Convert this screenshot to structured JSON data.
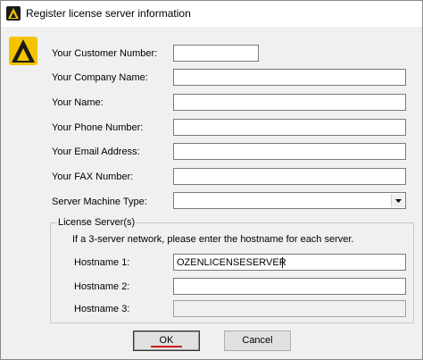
{
  "window": {
    "title": "Register license server information"
  },
  "form": {
    "customer_number": {
      "label": "Your Customer Number:",
      "value": ""
    },
    "company_name": {
      "label": "Your Company Name:",
      "value": ""
    },
    "name": {
      "label": "Your Name:",
      "value": ""
    },
    "phone": {
      "label": "Your Phone Number:",
      "value": ""
    },
    "email": {
      "label": "Your Email Address:",
      "value": ""
    },
    "fax": {
      "label": "Your FAX Number:",
      "value": ""
    },
    "machine_type": {
      "label": "Server Machine Type:",
      "value": ""
    }
  },
  "license_servers": {
    "group_title": "License Server(s)",
    "hint": "If a 3-server network, please enter the hostname for each server.",
    "hostname1": {
      "label": "Hostname 1:",
      "value": "OZENLICENSESERVER"
    },
    "hostname2": {
      "label": "Hostname 2:",
      "value": ""
    },
    "hostname3": {
      "label": "Hostname 3:",
      "value": ""
    }
  },
  "buttons": {
    "ok": "OK",
    "cancel": "Cancel"
  },
  "icons": {
    "app": "app-logo-icon",
    "dropdown": "chevron-down-icon"
  },
  "colors": {
    "logo_yellow": "#f5c400",
    "logo_dark": "#1a1a1a",
    "accent_red": "#d21a1a"
  }
}
